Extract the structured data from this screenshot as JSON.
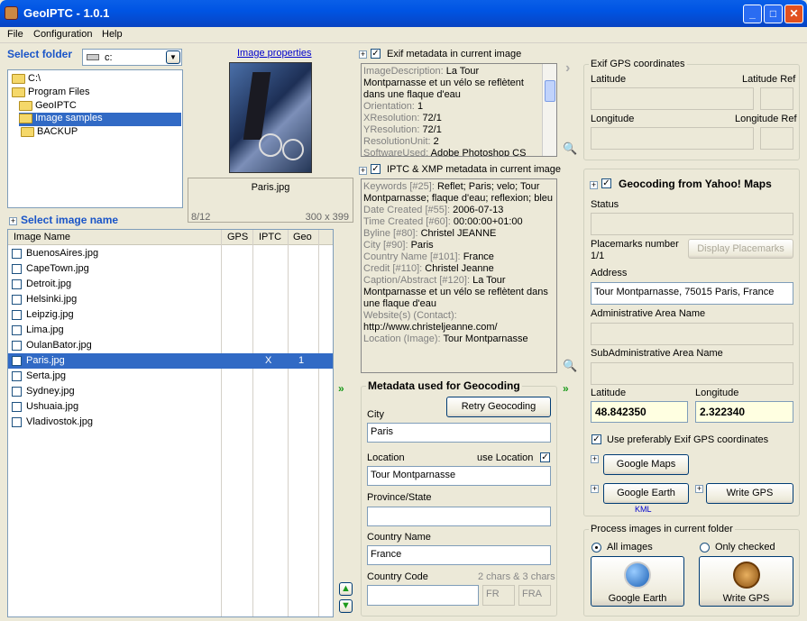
{
  "window": {
    "title": "GeoIPTC - 1.0.1"
  },
  "menu": [
    "File",
    "Configuration",
    "Help"
  ],
  "folder": {
    "label": "Select folder",
    "drive": "c:",
    "tree": [
      "C:\\",
      "Program Files",
      "GeoIPTC",
      "Image samples",
      "BACKUP"
    ],
    "selected_index": 3
  },
  "preview": {
    "link": "Image properties",
    "filename": "Paris.jpg",
    "counter": "8/12",
    "dimensions": "300 x 399"
  },
  "image_list": {
    "label": "Select image name",
    "columns": [
      "Image Name",
      "GPS",
      "IPTC",
      "Geo"
    ],
    "rows": [
      {
        "name": "BuenosAires.jpg",
        "gps": "",
        "iptc": "",
        "geo": ""
      },
      {
        "name": "CapeTown.jpg",
        "gps": "",
        "iptc": "",
        "geo": ""
      },
      {
        "name": "Detroit.jpg",
        "gps": "",
        "iptc": "",
        "geo": ""
      },
      {
        "name": "Helsinki.jpg",
        "gps": "",
        "iptc": "",
        "geo": ""
      },
      {
        "name": "Leipzig.jpg",
        "gps": "",
        "iptc": "",
        "geo": ""
      },
      {
        "name": "Lima.jpg",
        "gps": "",
        "iptc": "",
        "geo": ""
      },
      {
        "name": "OulanBator.jpg",
        "gps": "",
        "iptc": "",
        "geo": ""
      },
      {
        "name": "Paris.jpg",
        "gps": "",
        "iptc": "X",
        "geo": "1"
      },
      {
        "name": "Serta.jpg",
        "gps": "",
        "iptc": "",
        "geo": ""
      },
      {
        "name": "Sydney.jpg",
        "gps": "",
        "iptc": "",
        "geo": ""
      },
      {
        "name": "Ushuaia.jpg",
        "gps": "",
        "iptc": "",
        "geo": ""
      },
      {
        "name": "Vladivostok.jpg",
        "gps": "",
        "iptc": "",
        "geo": ""
      }
    ],
    "selected_index": 7
  },
  "exif": {
    "title": "Exif metadata in current image",
    "lines": [
      {
        "k": "ImageDescription:",
        "v": "La Tour Montparnasse et un vélo se reflètent dans une flaque d'eau"
      },
      {
        "k": "Orientation:",
        "v": "1"
      },
      {
        "k": "XResolution:",
        "v": "72/1"
      },
      {
        "k": "YResolution:",
        "v": "72/1"
      },
      {
        "k": "ResolutionUnit:",
        "v": "2"
      },
      {
        "k": "SoftwareUsed:",
        "v": "Adobe Photoshop CS"
      }
    ]
  },
  "iptc": {
    "title": "IPTC & XMP metadata in current image",
    "lines": [
      {
        "k": "Keywords [#25]:",
        "v": "Reflet; Paris; velo; Tour Montparnasse; flaque d'eau; reflexion; bleu"
      },
      {
        "k": "Date Created [#55]:",
        "v": "2006-07-13"
      },
      {
        "k": "Time Created [#60]:",
        "v": "00:00:00+01:00"
      },
      {
        "k": "Byline [#80]:",
        "v": "Christel JEANNE"
      },
      {
        "k": "City [#90]:",
        "v": "Paris"
      },
      {
        "k": "Country Name [#101]:",
        "v": "France"
      },
      {
        "k": "Credit [#110]:",
        "v": "Christel Jeanne"
      },
      {
        "k": "Caption/Abstract [#120]:",
        "v": "La Tour Montparnasse et un vélo se reflètent dans une flaque d'eau"
      },
      {
        "k": "Website(s) (Contact):",
        "v": "http://www.christeljeanne.com/"
      },
      {
        "k": "Location (Image):",
        "v": "Tour Montparnasse"
      }
    ]
  },
  "geometa": {
    "title": "Metadata used for Geocoding",
    "retry": "Retry Geocoding",
    "city_label": "City",
    "city": "Paris",
    "location_label": "Location",
    "use_location": "use Location",
    "location": "Tour Montparnasse",
    "province_label": "Province/State",
    "province": "",
    "country_label": "Country Name",
    "country": "France",
    "code_label": "Country Code",
    "code_hint": "2 chars & 3 chars",
    "code": "",
    "code2": "FR",
    "code3": "FRA"
  },
  "exif_gps": {
    "title": "Exif GPS coordinates",
    "lat": "Latitude",
    "lat_ref": "Latitude Ref",
    "lon": "Longitude",
    "lon_ref": "Longitude Ref"
  },
  "yahoo": {
    "title": "Geocoding from Yahoo! Maps",
    "status_label": "Status",
    "status": "",
    "placemarks_label": "Placemarks number",
    "placemarks": "1/1",
    "display_btn": "Display Placemarks",
    "address_label": "Address",
    "address": "Tour Montparnasse, 75015 Paris, France",
    "admin_label": "Administrative Area Name",
    "admin": "",
    "subadmin_label": "SubAdministrative Area Name",
    "subadmin": "",
    "lat_label": "Latitude",
    "lat": "48.842350",
    "lon_label": "Longitude",
    "lon": "2.322340",
    "prefer_exif": "Use preferably Exif GPS coordinates",
    "gmaps": "Google Maps",
    "gearth": "Google Earth",
    "kml": "KML",
    "writegps": "Write GPS"
  },
  "process": {
    "title": "Process images in current folder",
    "all": "All images",
    "checked": "Only checked",
    "gearth": "Google Earth",
    "writegps": "Write GPS"
  }
}
